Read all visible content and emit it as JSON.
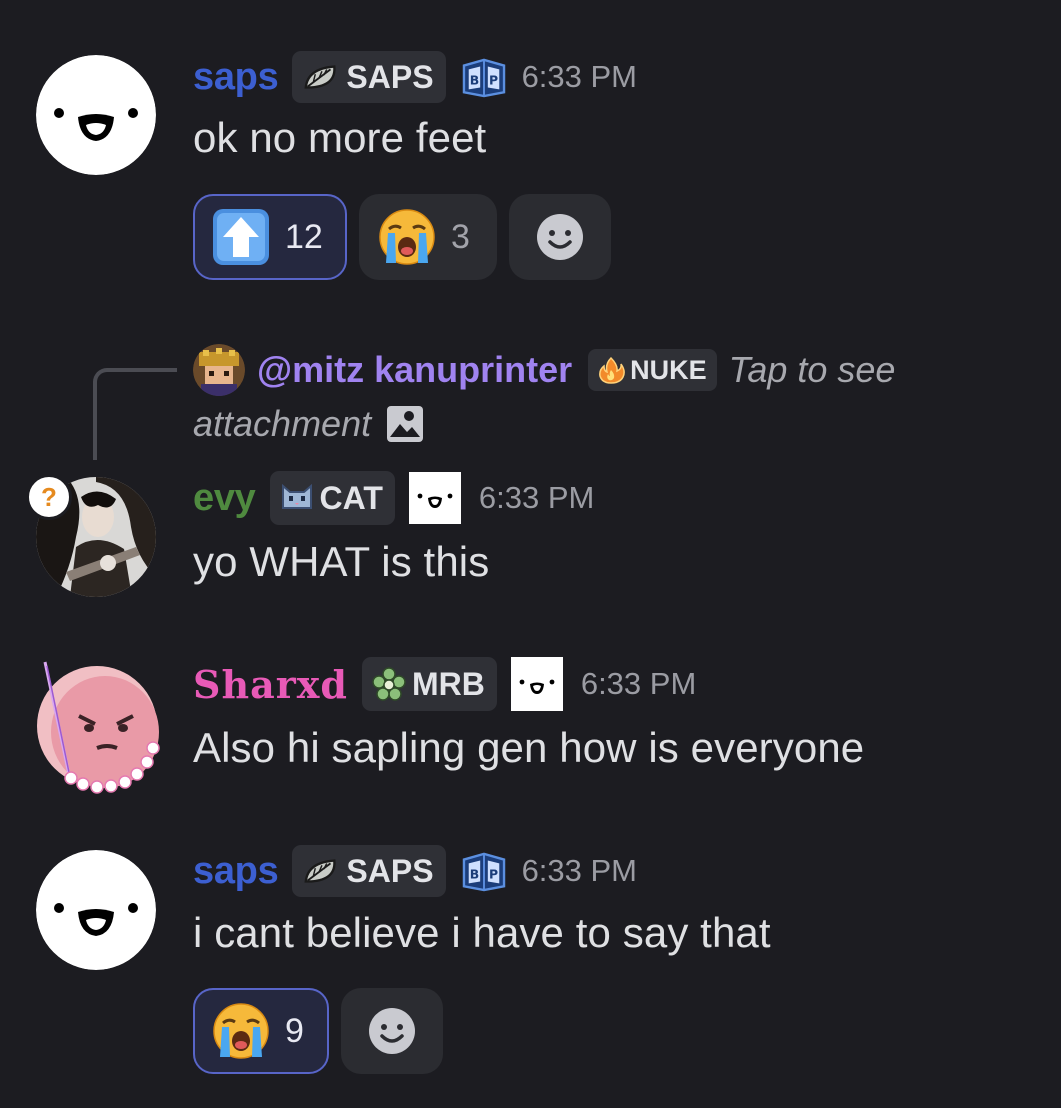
{
  "colors": {
    "background": "#1c1c21",
    "saps_name": "#3c5fd1",
    "evy_name": "#4f8a3f",
    "sharxd_name": "#e85ab7",
    "mitz_name": "#a083f0",
    "active_reaction_border": "#5865c8"
  },
  "messages": [
    {
      "username": "saps",
      "tag": {
        "icon": "leaf-icon",
        "label": "SAPS"
      },
      "badge_icon": "bp-book-icon",
      "timestamp": "6:33 PM",
      "text": "ok no more feet",
      "reactions": [
        {
          "emoji": "up-arrow-emoji",
          "count": "12",
          "active": true
        },
        {
          "emoji": "loudly-crying-emoji",
          "count": "3",
          "active": false
        }
      ]
    },
    {
      "reply": {
        "mention": "@mitz kanuprinter",
        "tag": {
          "icon": "fire-icon",
          "label": "NUKE"
        },
        "text_part1": "Tap to see",
        "text_part2": "attachment",
        "attachment_icon": "image-icon"
      },
      "username": "evy",
      "tag": {
        "icon": "cat-icon",
        "label": "CAT"
      },
      "badge_icon": "smiley-badge-icon",
      "status_icon": "question-icon",
      "status_text": "?",
      "timestamp": "6:33 PM",
      "text": "yo WHAT is this"
    },
    {
      "username": "Sharxd",
      "tag": {
        "icon": "flower-icon",
        "label": "MRB"
      },
      "badge_icon": "smiley-badge-icon",
      "timestamp": "6:33 PM",
      "text": "Also hi sapling gen how is everyone"
    },
    {
      "username": "saps",
      "tag": {
        "icon": "leaf-icon",
        "label": "SAPS"
      },
      "badge_icon": "bp-book-icon",
      "timestamp": "6:33 PM",
      "text": "i cant believe i have to say that",
      "reactions": [
        {
          "emoji": "loudly-crying-emoji",
          "count": "9",
          "active": true
        }
      ]
    }
  ]
}
